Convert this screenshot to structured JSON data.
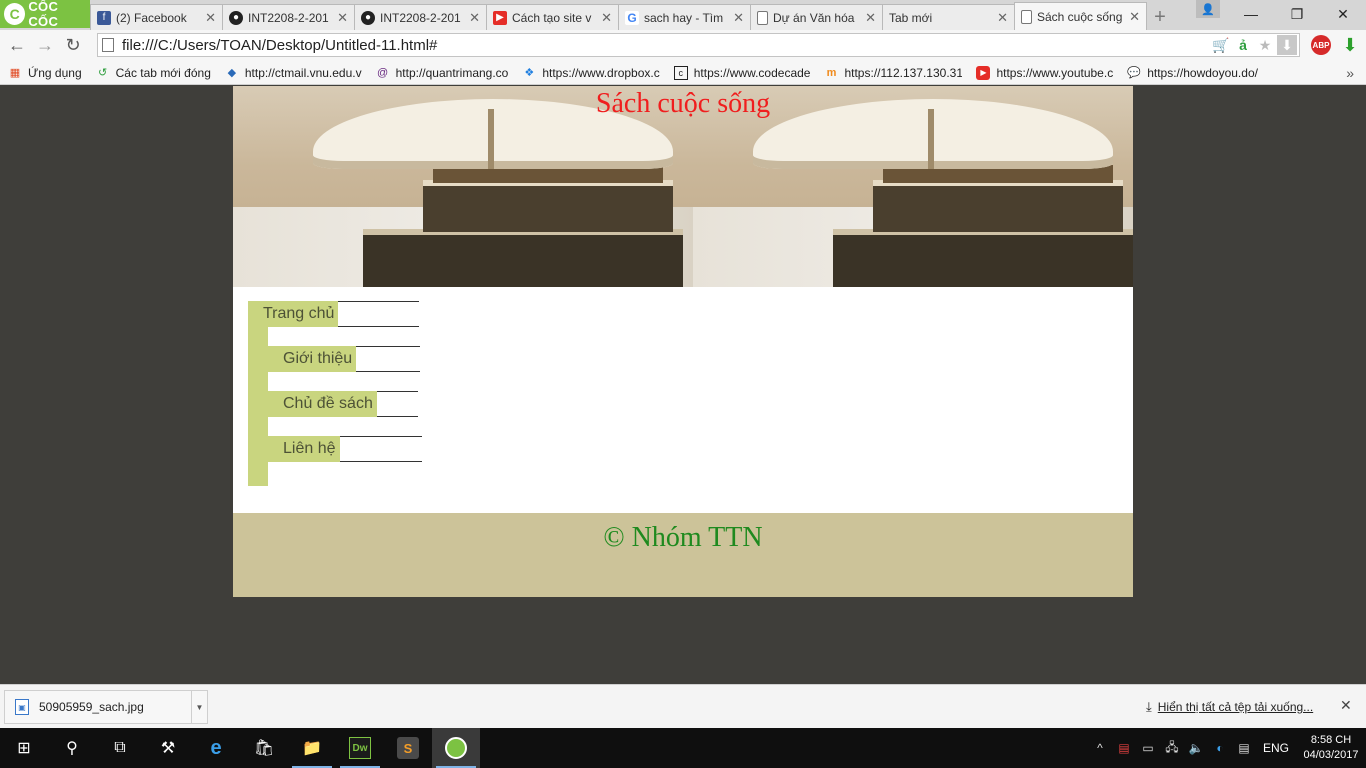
{
  "browser": {
    "brand": "CỐC CỐC",
    "tabs": [
      {
        "title": "(2) Facebook",
        "icon": "facebook-icon",
        "color": "#3b5998"
      },
      {
        "title": "INT2208-2-201",
        "icon": "github-icon",
        "color": "#222222"
      },
      {
        "title": "INT2208-2-201",
        "icon": "github-icon",
        "color": "#222222"
      },
      {
        "title": "Cách tạo site v",
        "icon": "youtube-icon",
        "color": "#e52d27"
      },
      {
        "title": "sach hay - Tìm",
        "icon": "google-icon",
        "color": "#4285f4"
      },
      {
        "title": "Dự án Văn hóa",
        "icon": "page-icon",
        "color": "#ffffff"
      },
      {
        "title": "Tab mới",
        "icon": "none",
        "color": "#ffffff"
      },
      {
        "title": "Sách cuộc sống",
        "icon": "page-icon",
        "color": "#ffffff",
        "active": true
      }
    ],
    "url": "file:///C:/Users/TOAN/Desktop/Untitled-11.html#",
    "bookmarks": [
      {
        "label": "Ứng dụng",
        "icon": "apps-grid-icon"
      },
      {
        "label": "Các tab mới đóng",
        "icon": "history-icon"
      },
      {
        "label": "http://ctmail.vnu.edu.v",
        "icon": "vnu-icon"
      },
      {
        "label": "http://quantrimang.co",
        "icon": "at-icon"
      },
      {
        "label": "https://www.dropbox.c",
        "icon": "dropbox-icon"
      },
      {
        "label": "https://www.codecade",
        "icon": "codecademy-icon"
      },
      {
        "label": "https://112.137.130.31",
        "icon": "moodle-icon"
      },
      {
        "label": "https://www.youtube.c",
        "icon": "youtube-icon"
      },
      {
        "label": "https://howdoyou.do/",
        "icon": "chat-icon"
      }
    ]
  },
  "page": {
    "site_title": "Sách cuộc sống",
    "menu": [
      {
        "label": "Trang chủ"
      },
      {
        "label": "Giới thiệu"
      },
      {
        "label": "Chủ đề sách"
      },
      {
        "label": "Liên hệ"
      }
    ],
    "footer": "© Nhóm TTN",
    "colors": {
      "title": "#f01e1e",
      "menu_bg": "#c9d57f",
      "footer_bg": "#ccc399",
      "footer_text": "#1f8a1f",
      "page_bg": "#3f3e3a"
    }
  },
  "downloads": {
    "item": "50905959_sach.jpg",
    "show_all": "Hiển thị tất cả tệp tải xuống..."
  },
  "taskbar": {
    "lang": "ENG",
    "time": "8:58 CH",
    "date": "04/03/2017"
  }
}
